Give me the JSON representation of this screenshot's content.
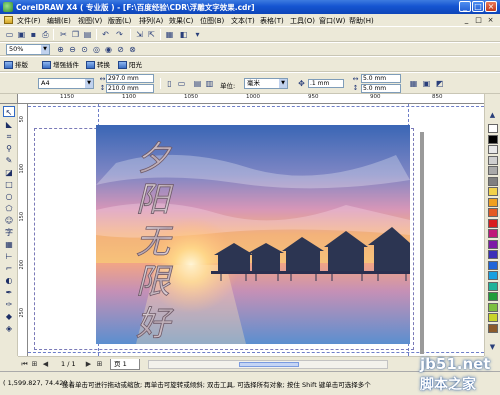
{
  "window": {
    "title": "CorelDRAW X4 ( 专业版 ) - [F:\\百度经验\\CDR\\浮雕文字效果.cdr]",
    "minimize": "_",
    "maximize": "□",
    "close": "×"
  },
  "menu": [
    "文件(F)",
    "编辑(E)",
    "视图(V)",
    "版面(L)",
    "排列(A)",
    "效果(C)",
    "位图(B)",
    "文本(T)",
    "表格(T)",
    "工具(O)",
    "窗口(W)",
    "帮助(H)"
  ],
  "mdi_controls": [
    "_",
    "□",
    "×"
  ],
  "zoom": {
    "value": "50%"
  },
  "plugins": [
    "排版",
    "增强插件",
    "转换",
    "阳光"
  ],
  "propbar": {
    "paper_size": "A4",
    "width": "297.0 mm",
    "height": "210.0 mm",
    "units_label": "单位:",
    "units": "毫米",
    "nudge": ".1 mm",
    "dup_x": "5.0 mm",
    "dup_y": "5.0 mm"
  },
  "ruler": {
    "h_labels": [
      "1150",
      "1100",
      "1050",
      "1000",
      "950",
      "900",
      "850"
    ],
    "v_labels": [
      "50",
      "100",
      "150",
      "200",
      "250"
    ]
  },
  "artwork": {
    "calligraphy": [
      "夕",
      "阳",
      "无",
      "限",
      "好"
    ]
  },
  "palette": {
    "colors": [
      "#ffffff",
      "#000000",
      "#e8e8e8",
      "#cfcfcf",
      "#a9a9a9",
      "#7f7f7f",
      "#f2d24a",
      "#f0a020",
      "#e35a22",
      "#d81e1e",
      "#c0187a",
      "#7d1aa6",
      "#3b2fb8",
      "#1e64d8",
      "#1aa0e0",
      "#1fb39a",
      "#1e9c3a",
      "#7dc040",
      "#c8d42a",
      "#8b5a2b"
    ]
  },
  "pages": {
    "counter": "1 / 1",
    "tab": "页 1"
  },
  "status": {
    "coords": "( 1,599.827, 74.420 )",
    "hint": "接着单击可进行拖动或缩放; 再单击可旋转或倾斜; 双击工具, 可选择所有对象; 按住 Shift 键单击可选择多个"
  },
  "watermark": {
    "site": "jb51.net",
    "name": "脚本之家"
  }
}
